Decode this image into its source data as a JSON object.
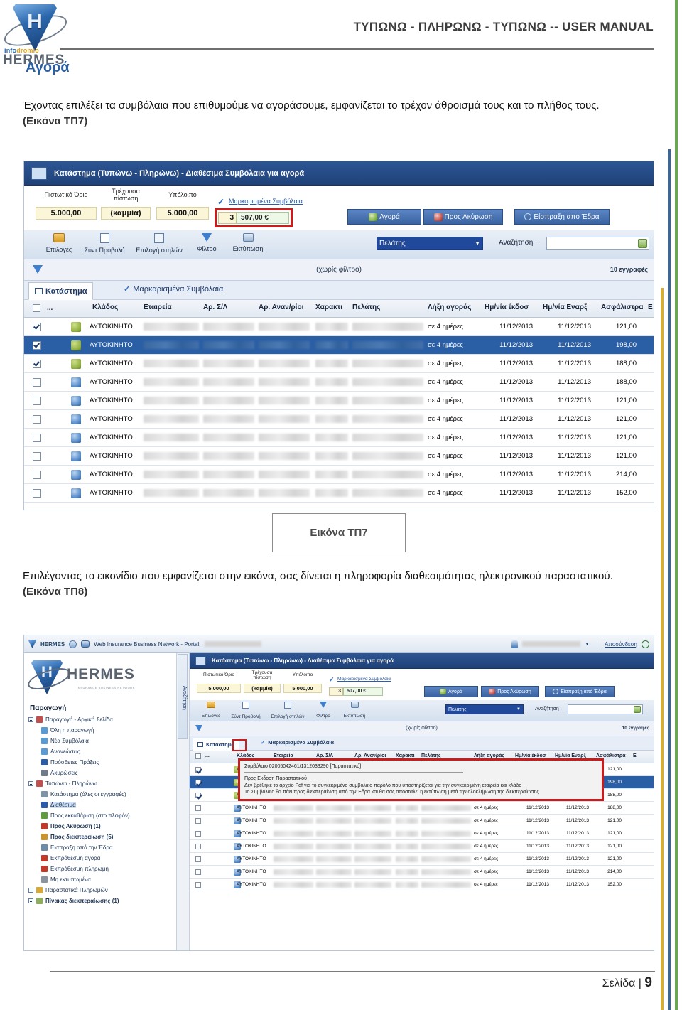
{
  "document": {
    "header_title": "ΤΥΠΩΝΩ - ΠΛΗΡΩΝΩ - ΤΥΠΩΝΩ -- USER MANUAL",
    "brand_mark": "H",
    "brand_info_1": "info",
    "brand_info_2": "dromio",
    "brand_name": "HERMES",
    "section_heading": "Αγορά",
    "paragraph_1": "Έχοντας επιλέξει τα συμβόλαια που επιθυμούμε να αγοράσουμε, εμφανίζεται το τρέχον άθροισμά τους και το πλήθος τους.",
    "paragraph_1_ref": "(Εικόνα ΤΠ7)",
    "caption_1": "Εικόνα ΤΠ7",
    "paragraph_2": "Επιλέγοντας το εικονίδιο που εμφανίζεται στην εικόνα, σας δίνεται η πληροφορία διαθεσιμότητας ηλεκτρονικού παραστατικού.",
    "paragraph_2_ref": "(Εικόνα ΤΠ8)",
    "footer_label": "Σελίδα |",
    "footer_page": "9",
    "accent_blue": "#2b5fa5",
    "accent_green": "#6aa84f",
    "accent_yellow": "#d4ad3a",
    "accent_red": "#cc1b1b"
  },
  "app": {
    "window_title": "Κατάστημα (Τυπώνω - Πληρώνω) - Διαθέσιμα Συμβόλαια για αγορά",
    "credit": {
      "limit_label": "Πιστωτικό Όριο",
      "limit_value": "5.000,00",
      "current_label": "Τρέχουσα πίστωση",
      "current_value": "(καμμία)",
      "balance_label": "Υπόλοιπο",
      "balance_value": "5.000,00",
      "marked_link": "Μαρκαρισμένα Συμβόλαια",
      "selected_count": "3",
      "selected_sum": "507,00 €"
    },
    "action_buttons": [
      {
        "label": "Αγορά",
        "icon": "cart-green-icon"
      },
      {
        "label": "Προς Ακύρωση",
        "icon": "cart-red-icon"
      },
      {
        "label": "Είσπραξη από Έδρα",
        "icon": "receipt-icon"
      }
    ],
    "toolbar": [
      {
        "label": "Επιλογές",
        "icon": "folder-icon"
      },
      {
        "label": "Σύντ Προβολή",
        "icon": "list-icon"
      },
      {
        "label": "Επιλογή στηλών",
        "icon": "columns-icon"
      },
      {
        "label": "Φίλτρο",
        "icon": "funnel-icon"
      },
      {
        "label": "Εκτύπωση",
        "icon": "printer-icon"
      }
    ],
    "search": {
      "field_selected": "Πελάτης",
      "label": "Αναζήτηση :",
      "value": "",
      "placeholder": ""
    },
    "filter_bar": {
      "icon": "funnel-icon",
      "status": "(χωρίς φίλτρο)",
      "record_count": "10 εγγραφές"
    },
    "tabs": [
      {
        "label": "Κατάστημα",
        "icon": "cart-icon",
        "active": true
      },
      {
        "label": "Μαρκαρισμένα Συμβόλαια",
        "icon": "check-icon",
        "active": false
      }
    ],
    "grid": {
      "columns": [
        "",
        "...",
        "",
        "Κλάδος",
        "Εταιρεία",
        "Αρ. Σ/Λ",
        "Αρ. Αναν/ρίοι",
        "Χαρακτι",
        "Πελάτης",
        "Λήξη αγοράς",
        "Ημ/νία έκδοσ",
        "Ημ/νία Εναρξ",
        "Ασφάλιστρα",
        "Ε"
      ],
      "rows": [
        {
          "checked": true,
          "icon": "green",
          "klados": "ΑΥΤΟΚΙΝΗΤΟ",
          "lixi": "σε 4 ημέρες",
          "ekdosis": "11/12/2013",
          "enarxis": "11/12/2013",
          "asfalistra": "121,00",
          "selected": false
        },
        {
          "checked": true,
          "icon": "green",
          "klados": "ΑΥΤΟΚΙΝΗΤΟ",
          "lixi": "σε 4 ημέρες",
          "ekdosis": "11/12/2013",
          "enarxis": "11/12/2013",
          "asfalistra": "198,00",
          "selected": true
        },
        {
          "checked": true,
          "icon": "green",
          "klados": "ΑΥΤΟΚΙΝΗΤΟ",
          "lixi": "σε 4 ημέρες",
          "ekdosis": "11/12/2013",
          "enarxis": "11/12/2013",
          "asfalistra": "188,00",
          "selected": false
        },
        {
          "checked": false,
          "icon": "blue",
          "klados": "ΑΥΤΟΚΙΝΗΤΟ",
          "lixi": "σε 4 ημέρες",
          "ekdosis": "11/12/2013",
          "enarxis": "11/12/2013",
          "asfalistra": "188,00",
          "selected": false
        },
        {
          "checked": false,
          "icon": "blue",
          "klados": "ΑΥΤΟΚΙΝΗΤΟ",
          "lixi": "σε 4 ημέρες",
          "ekdosis": "11/12/2013",
          "enarxis": "11/12/2013",
          "asfalistra": "121,00",
          "selected": false
        },
        {
          "checked": false,
          "icon": "blue",
          "klados": "ΑΥΤΟΚΙΝΗΤΟ",
          "lixi": "σε 4 ημέρες",
          "ekdosis": "11/12/2013",
          "enarxis": "11/12/2013",
          "asfalistra": "121,00",
          "selected": false
        },
        {
          "checked": false,
          "icon": "blue",
          "klados": "ΑΥΤΟΚΙΝΗΤΟ",
          "lixi": "σε 4 ημέρες",
          "ekdosis": "11/12/2013",
          "enarxis": "11/12/2013",
          "asfalistra": "121,00",
          "selected": false
        },
        {
          "checked": false,
          "icon": "blue",
          "klados": "ΑΥΤΟΚΙΝΗΤΟ",
          "lixi": "σε 4 ημέρες",
          "ekdosis": "11/12/2013",
          "enarxis": "11/12/2013",
          "asfalistra": "121,00",
          "selected": false
        },
        {
          "checked": false,
          "icon": "blue",
          "klados": "ΑΥΤΟΚΙΝΗΤΟ",
          "lixi": "σε 4 ημέρες",
          "ekdosis": "11/12/2013",
          "enarxis": "11/12/2013",
          "asfalistra": "214,00",
          "selected": false
        },
        {
          "checked": false,
          "icon": "blue",
          "klados": "ΑΥΤΟΚΙΝΗΤΟ",
          "lixi": "σε 4 ημέρες",
          "ekdosis": "11/12/2013",
          "enarxis": "11/12/2013",
          "asfalistra": "152,00",
          "selected": false
        }
      ]
    }
  },
  "portal": {
    "brand": "HERMES",
    "title": "Web Insurance Business Network - Portal:",
    "portal_value": "",
    "user_value": "",
    "logout": "Αποσύνδεση",
    "vertical_tab": "Αναζήτηση",
    "sidebar": {
      "logo_text": "HERMES",
      "logo_sub": "INSURANCE BUSINESS NETWORK",
      "title": "Παραγωγή",
      "items": [
        {
          "label": "Παραγωγή - Αρχική Σελίδα",
          "level": 1,
          "icon": "home-icon",
          "expander": true,
          "bold": false,
          "selected": false
        },
        {
          "label": "Όλη η παραγωγή",
          "level": 2,
          "icon": "db-icon",
          "expander": false,
          "bold": false,
          "selected": false
        },
        {
          "label": "Νέα Συμβόλαια",
          "level": 2,
          "icon": "doc-icon",
          "expander": false,
          "bold": false,
          "selected": false
        },
        {
          "label": "Ανανεώσεις",
          "level": 2,
          "icon": "copy-icon",
          "expander": false,
          "bold": false,
          "selected": false
        },
        {
          "label": "Πρόσθετες Πράξεις",
          "level": 2,
          "icon": "edit-icon",
          "expander": false,
          "bold": false,
          "selected": false
        },
        {
          "label": "Ακυρώσεις",
          "level": 2,
          "icon": "cancel-icon",
          "expander": false,
          "bold": false,
          "selected": false
        },
        {
          "label": "Τυπώνω - Πληρώνω",
          "level": 1,
          "icon": "home-icon",
          "expander": true,
          "bold": false,
          "selected": false
        },
        {
          "label": "Κατάστημα (όλες οι εγγραφές)",
          "level": 2,
          "icon": "shop-icon",
          "expander": false,
          "bold": false,
          "selected": false
        },
        {
          "label": "Διαθέσιμα",
          "level": 2,
          "icon": "cart-icon",
          "expander": false,
          "bold": false,
          "selected": true
        },
        {
          "label": "Προς εκκαθάριση (στο πλαφόν)",
          "level": 2,
          "icon": "cart-green-icon",
          "expander": false,
          "bold": false,
          "selected": false
        },
        {
          "label": "Προς Ακύρωση (1)",
          "level": 2,
          "icon": "cart-red-icon",
          "expander": false,
          "bold": true,
          "selected": false
        },
        {
          "label": "Προς διεκπεραίωση (5)",
          "level": 2,
          "icon": "bag-icon",
          "expander": false,
          "bold": true,
          "selected": false
        },
        {
          "label": "Είσπραξη από την Έδρα",
          "level": 2,
          "icon": "link-icon",
          "expander": false,
          "bold": false,
          "selected": false
        },
        {
          "label": "Εκπρόθεσμη αγορά",
          "level": 2,
          "icon": "cart-red-icon",
          "expander": false,
          "bold": false,
          "selected": false
        },
        {
          "label": "Εκπρόθεσμη πληρωμή",
          "level": 2,
          "icon": "flag-icon",
          "expander": false,
          "bold": false,
          "selected": false
        },
        {
          "label": "Μη εκτυπωμένα",
          "level": 2,
          "icon": "printer-icon",
          "expander": false,
          "bold": false,
          "selected": false
        },
        {
          "label": "Παραστατικά Πληρωμών",
          "level": 1,
          "icon": "folder-icon",
          "expander": true,
          "bold": false,
          "selected": false
        },
        {
          "label": "Πίνακας διεκπεραίωσης (1)",
          "level": 1,
          "icon": "board-icon",
          "expander": true,
          "bold": true,
          "selected": false
        }
      ]
    },
    "tooltip": {
      "title": "Συμβόλαιο 02005042461/1312033290 [Παραστατικό]",
      "line1": "Προς Εκδοση Παραστατικού",
      "line2": "Δεν βρέθηκε το αρχείο Pdf για το συγκεκριμένο συμβόλαιο παρόλο που υποστηρίζεται για την συγκεκριμένη εταιρεία και κλάδο",
      "line3": "Το Συμβόλαιο θα πάει προς διεκπεραίωση από την Έδρα και θα σας αποσταλεί η εκτύπωση μετά την ολοκλήρωση της διεκπεραίωσης"
    }
  }
}
